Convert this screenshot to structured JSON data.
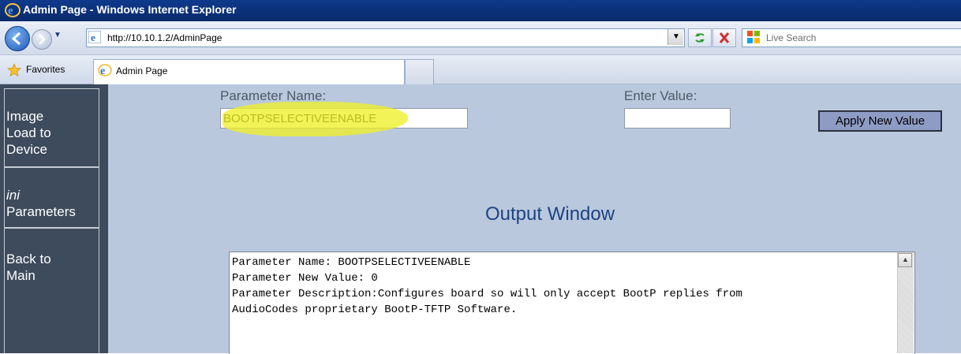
{
  "window": {
    "title": "Admin Page - Windows Internet Explorer"
  },
  "addressbar": {
    "url": "http://10.10.1.2/AdminPage",
    "search_placeholder": "Live Search"
  },
  "favorites": {
    "label": "Favorites"
  },
  "tabs": [
    {
      "label": "Admin Page",
      "active": true
    }
  ],
  "sidebar": {
    "items": [
      {
        "line1": "Image",
        "line2": "Load to",
        "line3": "Device"
      },
      {
        "line1": "ini",
        "line2": "Parameters"
      },
      {
        "line1": "Back to",
        "line2": "Main"
      }
    ]
  },
  "form": {
    "param_label": "Parameter Name:",
    "param_value": "BOOTPSELECTIVEENABLE",
    "value_label": "Enter Value:",
    "value_value": "",
    "apply_label": "Apply New Value"
  },
  "output": {
    "title": "Output Window",
    "lines": [
      "Parameter Name: BOOTPSELECTIVEENABLE",
      "Parameter New Value: 0",
      "Parameter Description:Configures board so will only accept BootP replies from",
      "AudioCodes proprietary BootP-TFTP Software."
    ]
  },
  "colors": {
    "titlebar": "#0c3380",
    "sidebar": "#3d4b5c",
    "content_bg": "#b9c8dd",
    "highlight": "#eef028",
    "output_title": "#1d4384"
  }
}
